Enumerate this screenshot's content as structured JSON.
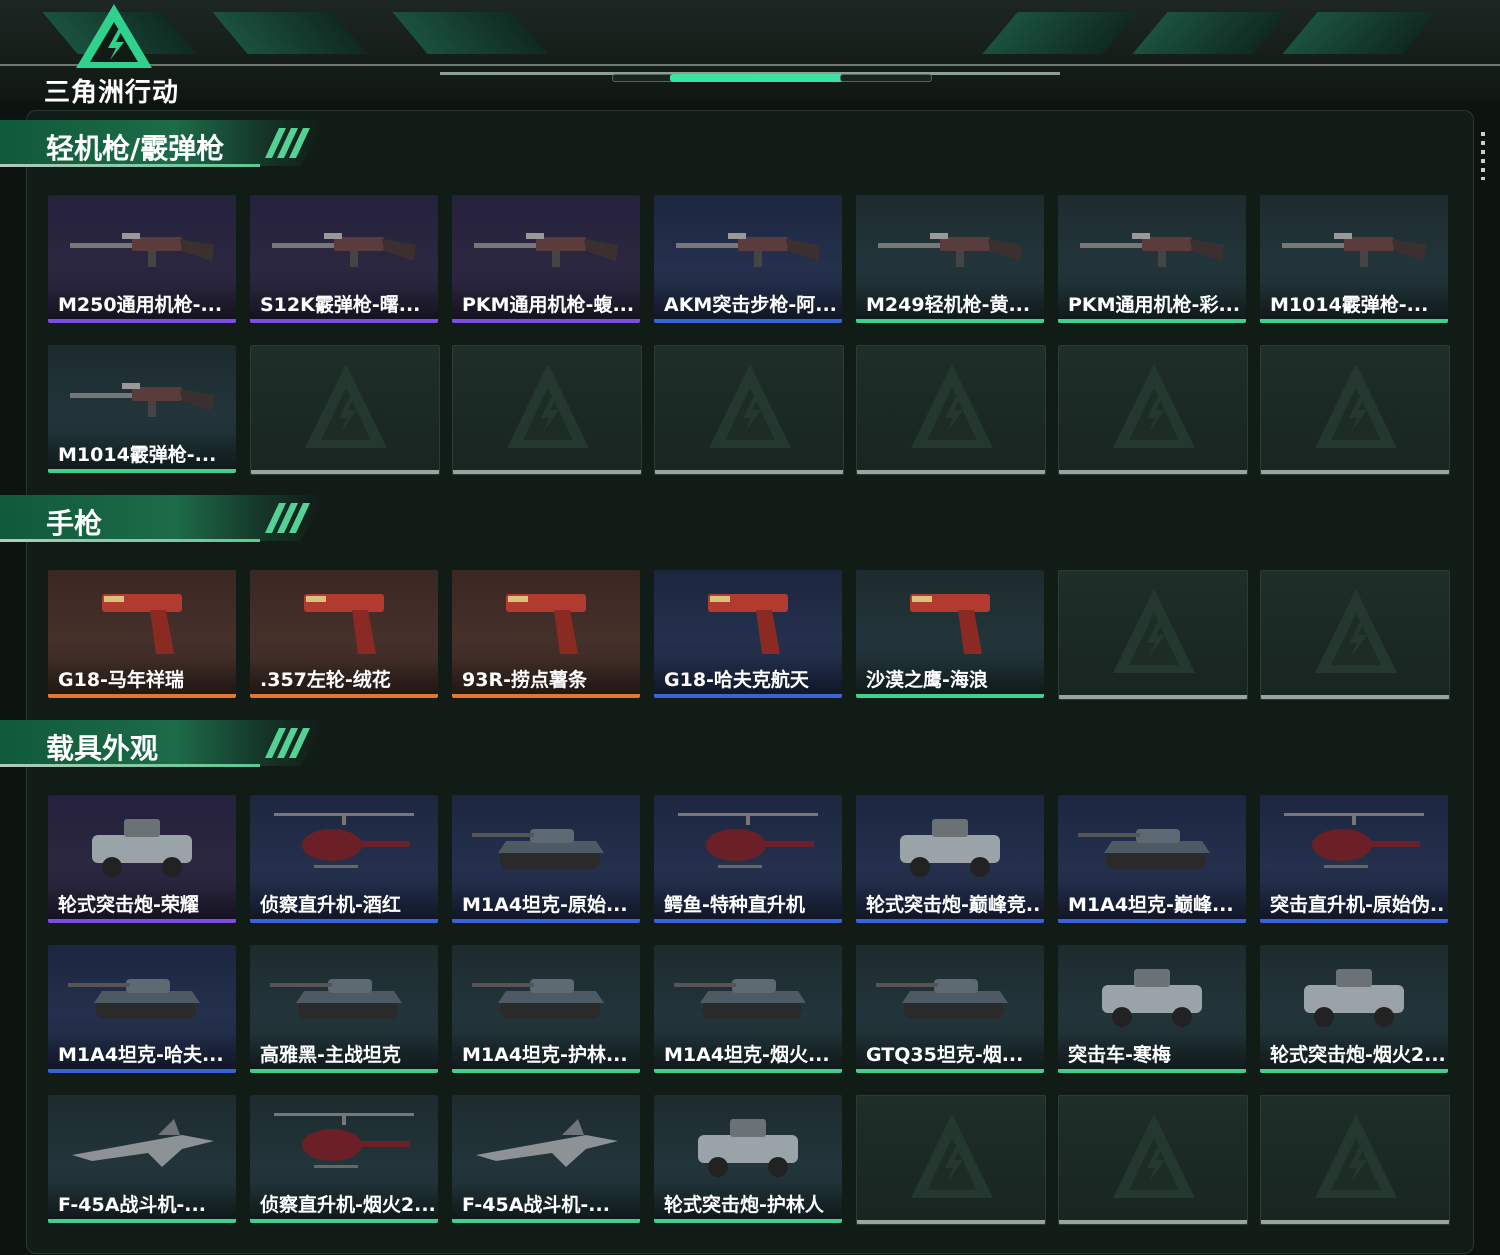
{
  "brand": {
    "logo_text": "三角洲行动",
    "accent": "#3de3a0"
  },
  "sections": [
    {
      "title": "轻机枪/霰弹枪",
      "items": [
        {
          "label": "M250通用机枪-...",
          "rarity": "purple",
          "icon": "machine-gun-icon"
        },
        {
          "label": "S12K霰弹枪-曙...",
          "rarity": "purple",
          "icon": "shotgun-icon"
        },
        {
          "label": "PKM通用机枪-蝮...",
          "rarity": "purple",
          "icon": "machine-gun-icon"
        },
        {
          "label": "AKM突击步枪-阿...",
          "rarity": "blue",
          "icon": "rifle-icon"
        },
        {
          "label": "M249轻机枪-黄...",
          "rarity": "green",
          "icon": "machine-gun-icon"
        },
        {
          "label": "PKM通用机枪-彩...",
          "rarity": "green",
          "icon": "machine-gun-icon"
        },
        {
          "label": "M1014霰弹枪-...",
          "rarity": "green",
          "icon": "shotgun-icon"
        },
        {
          "label": "M1014霰弹枪-...",
          "rarity": "green",
          "icon": "shotgun-icon"
        },
        {
          "label": "",
          "rarity": "empty"
        },
        {
          "label": "",
          "rarity": "empty"
        },
        {
          "label": "",
          "rarity": "empty"
        },
        {
          "label": "",
          "rarity": "empty"
        },
        {
          "label": "",
          "rarity": "empty"
        },
        {
          "label": "",
          "rarity": "empty"
        }
      ]
    },
    {
      "title": "手枪",
      "items": [
        {
          "label": "G18-马年祥瑞",
          "rarity": "orange",
          "icon": "pistol-icon"
        },
        {
          "label": ".357左轮-绒花",
          "rarity": "orange",
          "icon": "revolver-icon"
        },
        {
          "label": "93R-捞点薯条",
          "rarity": "orange",
          "icon": "pistol-icon"
        },
        {
          "label": "G18-哈夫克航天",
          "rarity": "blue",
          "icon": "pistol-icon"
        },
        {
          "label": "沙漠之鹰-海浪",
          "rarity": "green",
          "icon": "pistol-icon"
        },
        {
          "label": "",
          "rarity": "empty"
        },
        {
          "label": "",
          "rarity": "empty"
        }
      ]
    },
    {
      "title": "载具外观",
      "items": [
        {
          "label": "轮式突击炮-荣耀",
          "rarity": "purple",
          "icon": "armored-car-icon"
        },
        {
          "label": "侦察直升机-酒红",
          "rarity": "blue",
          "icon": "helicopter-icon"
        },
        {
          "label": "M1A4坦克-原始...",
          "rarity": "blue",
          "icon": "tank-icon"
        },
        {
          "label": "鳄鱼-特种直升机",
          "rarity": "blue",
          "icon": "helicopter-icon"
        },
        {
          "label": "轮式突击炮-巅峰竞...",
          "rarity": "blue",
          "icon": "armored-car-icon"
        },
        {
          "label": "M1A4坦克-巅峰...",
          "rarity": "blue",
          "icon": "tank-icon"
        },
        {
          "label": "突击直升机-原始伪...",
          "rarity": "blue",
          "icon": "helicopter-icon"
        },
        {
          "label": "M1A4坦克-哈夫...",
          "rarity": "blue",
          "icon": "tank-icon"
        },
        {
          "label": "高雅黑-主战坦克",
          "rarity": "green",
          "icon": "tank-icon"
        },
        {
          "label": "M1A4坦克-护林...",
          "rarity": "green",
          "icon": "tank-icon"
        },
        {
          "label": "M1A4坦克-烟火...",
          "rarity": "green",
          "icon": "tank-icon"
        },
        {
          "label": "GTQ35坦克-烟...",
          "rarity": "green",
          "icon": "tank-icon"
        },
        {
          "label": "突击车-寒梅",
          "rarity": "green",
          "icon": "armored-car-icon"
        },
        {
          "label": "轮式突击炮-烟火2...",
          "rarity": "green",
          "icon": "armored-car-icon"
        },
        {
          "label": "F-45A战斗机-...",
          "rarity": "green",
          "icon": "fighter-jet-icon"
        },
        {
          "label": "侦察直升机-烟火2...",
          "rarity": "green",
          "icon": "helicopter-icon"
        },
        {
          "label": "F-45A战斗机-...",
          "rarity": "green",
          "icon": "fighter-jet-icon"
        },
        {
          "label": "轮式突击炮-护林人",
          "rarity": "green",
          "icon": "armored-car-icon"
        },
        {
          "label": "",
          "rarity": "empty"
        },
        {
          "label": "",
          "rarity": "empty"
        },
        {
          "label": "",
          "rarity": "empty"
        }
      ]
    }
  ]
}
